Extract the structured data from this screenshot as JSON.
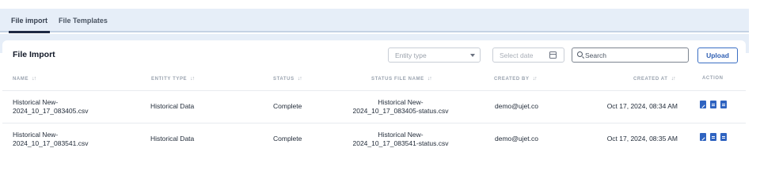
{
  "tabs": [
    {
      "label": "File import",
      "active": true
    },
    {
      "label": "File Templates",
      "active": false
    }
  ],
  "card": {
    "title": "File Import",
    "entity_select": {
      "placeholder": "Entity type",
      "icon": "chevron-down-icon"
    },
    "date_picker": {
      "placeholder": "Select date",
      "icon": "calendar-icon"
    },
    "search": {
      "placeholder": "Search",
      "value": "",
      "icon": "search-icon"
    },
    "upload_label": "Upload"
  },
  "table": {
    "columns": [
      {
        "label": "NAME",
        "sortable": true
      },
      {
        "label": "ENTITY TYPE",
        "sortable": true
      },
      {
        "label": "STATUS",
        "sortable": true
      },
      {
        "label": "STATUS FILE NAME",
        "sortable": true
      },
      {
        "label": "CREATED BY",
        "sortable": true
      },
      {
        "label": "CREATED AT",
        "sortable": true
      },
      {
        "label": "ACTION",
        "sortable": false
      }
    ],
    "sort_glyph": "↓↑",
    "rows": [
      {
        "name_line1": "Historical New-",
        "name_line2": "2024_10_17_083405.csv",
        "entity_type": "Historical Data",
        "status": "Complete",
        "status_file_line1": "Historical New-",
        "status_file_line2": "2024_10_17_083405-status.csv",
        "created_by": "demo@ujet.co",
        "created_at": "Oct 17, 2024, 08:34 AM",
        "actions": [
          "edit-icon",
          "file-icon",
          "file-icon"
        ]
      },
      {
        "name_line1": "Historical New-",
        "name_line2": "2024_10_17_083541.csv",
        "entity_type": "Historical Data",
        "status": "Complete",
        "status_file_line1": "Historical New-",
        "status_file_line2": "2024_10_17_083541-status.csv",
        "created_by": "demo@ujet.co",
        "created_at": "Oct 17, 2024, 08:35 AM",
        "actions": [
          "edit-icon",
          "file-icon",
          "file-icon"
        ]
      }
    ]
  },
  "colors": {
    "tab_bar_bg": "#e6eef8",
    "accent": "#2f63c0",
    "header_text": "#9aa3af"
  }
}
